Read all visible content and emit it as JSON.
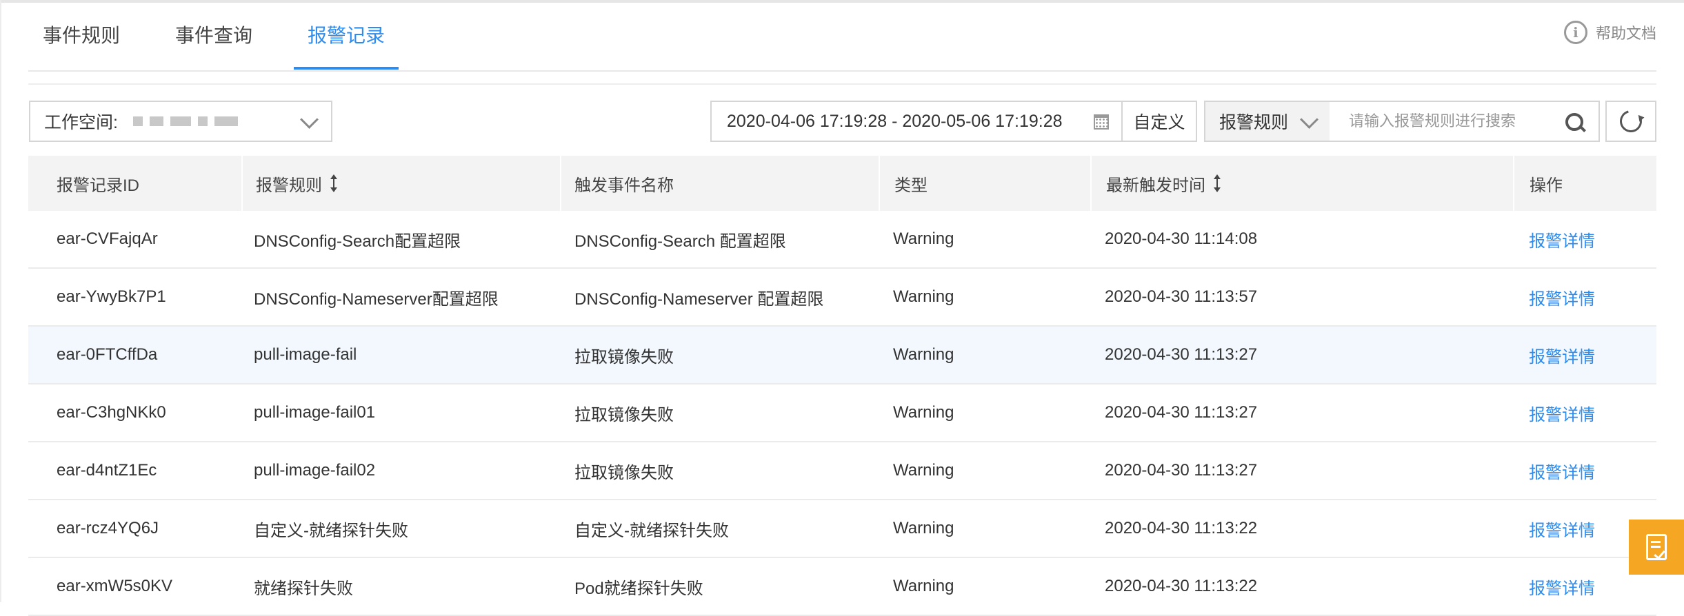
{
  "tabs": [
    {
      "label": "事件规则"
    },
    {
      "label": "事件查询"
    },
    {
      "label": "报警记录"
    }
  ],
  "help": {
    "label": "帮助文档",
    "icon": "info-icon"
  },
  "toolbar": {
    "workspace_label": "工作空间:",
    "date_range": "2020-04-06 17:19:28 - 2020-05-06 17:19:28",
    "custom_label": "自定义",
    "rule_select_label": "报警规则",
    "search_placeholder": "请输入报警规则进行搜索"
  },
  "table": {
    "headers": [
      "报警记录ID",
      "报警规则",
      "触发事件名称",
      "类型",
      "最新触发时间",
      "操作"
    ],
    "rows": [
      {
        "id": "ear-CVFajqAr",
        "rule": "DNSConfig-Search配置超限",
        "event": "DNSConfig-Search 配置超限",
        "type": "Warning",
        "time": "2020-04-30 11:14:08",
        "action": "报警详情"
      },
      {
        "id": "ear-YwyBk7P1",
        "rule": "DNSConfig-Nameserver配置超限",
        "event": "DNSConfig-Nameserver 配置超限",
        "type": "Warning",
        "time": "2020-04-30 11:13:57",
        "action": "报警详情"
      },
      {
        "id": "ear-0FTCffDa",
        "rule": "pull-image-fail",
        "event": "拉取镜像失败",
        "type": "Warning",
        "time": "2020-04-30 11:13:27",
        "action": "报警详情"
      },
      {
        "id": "ear-C3hgNKk0",
        "rule": "pull-image-fail01",
        "event": "拉取镜像失败",
        "type": "Warning",
        "time": "2020-04-30 11:13:27",
        "action": "报警详情"
      },
      {
        "id": "ear-d4ntZ1Ec",
        "rule": "pull-image-fail02",
        "event": "拉取镜像失败",
        "type": "Warning",
        "time": "2020-04-30 11:13:27",
        "action": "报警详情"
      },
      {
        "id": "ear-rcz4YQ6J",
        "rule": "自定义-就绪探针失败",
        "event": "自定义-就绪探针失败",
        "type": "Warning",
        "time": "2020-04-30 11:13:22",
        "action": "报警详情"
      },
      {
        "id": "ear-xmW5s0KV",
        "rule": "就绪探针失败",
        "event": "Pod就绪探针失败",
        "type": "Warning",
        "time": "2020-04-30 11:13:22",
        "action": "报警详情"
      }
    ]
  },
  "colors": {
    "accent": "#2d8cf0",
    "float_button": "#f5a623",
    "highlight_row": "#f2f8fd"
  }
}
